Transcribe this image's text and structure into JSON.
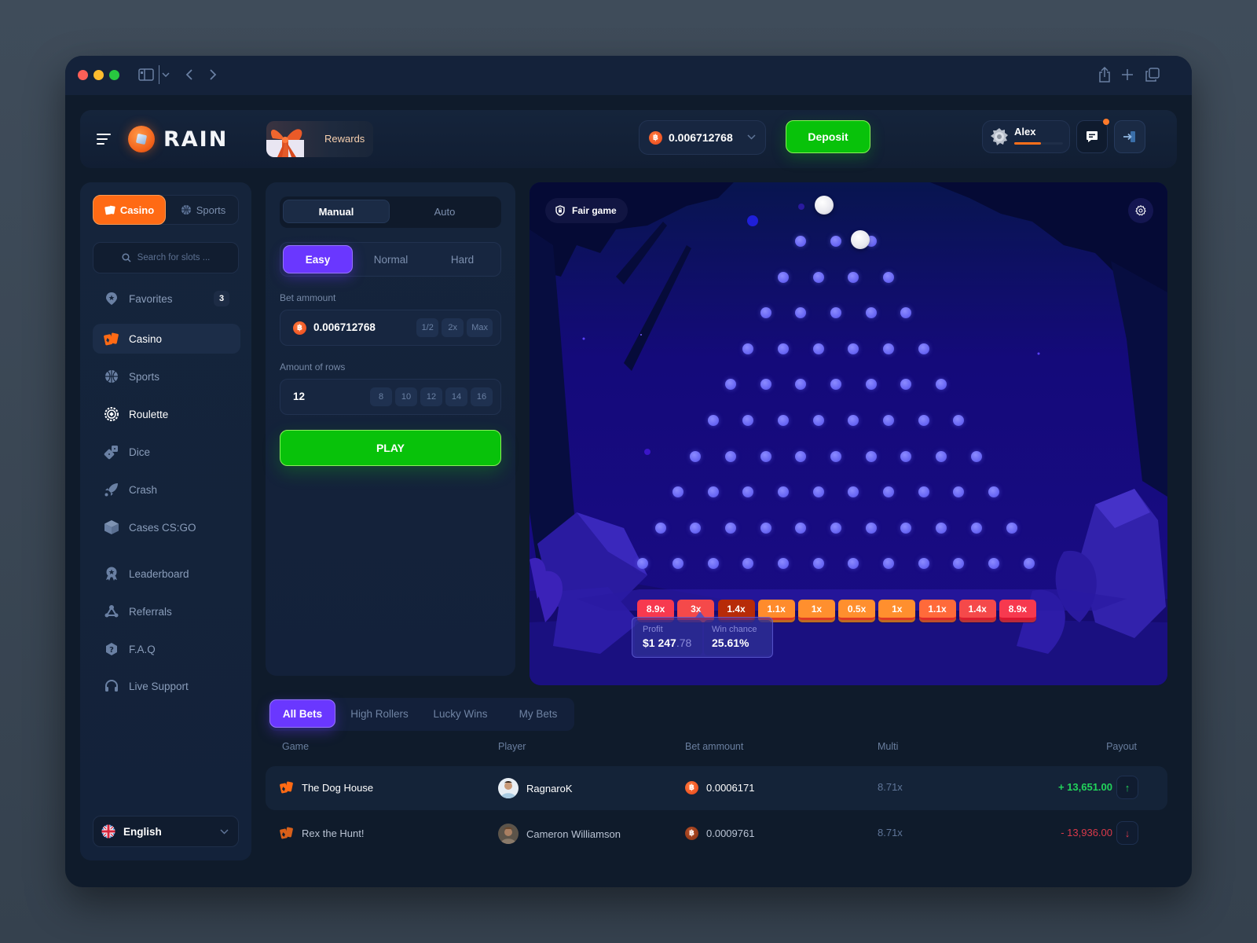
{
  "browser": {
    "traffic_lights": [
      "close",
      "minimize",
      "zoom"
    ],
    "toolbar_icons": [
      "sidebar-icon",
      "chevron-down-icon",
      "back-icon",
      "forward-icon",
      "share-icon",
      "plus-icon",
      "tabs-icon"
    ]
  },
  "header": {
    "brand": "RAIN",
    "rewards_label": "Rewards",
    "balance": "0.006712768",
    "currency_symbol": "฿",
    "deposit_label": "Deposit",
    "user_name": "Alex",
    "level_progress": 0.55,
    "chat_notification": true
  },
  "sidebar": {
    "segment": {
      "casino": "Casino",
      "sports": "Sports",
      "active": "casino"
    },
    "search_placeholder": "Search for slots ...",
    "items": [
      {
        "label": "Favorites",
        "icon": "favorites-icon",
        "badge": "3"
      },
      {
        "label": "Casino",
        "icon": "cards-icon",
        "active": true
      },
      {
        "label": "Sports",
        "icon": "basketball-icon"
      },
      {
        "label": "Roulette",
        "icon": "roulette-icon"
      },
      {
        "label": "Dice",
        "icon": "dice-icon"
      },
      {
        "label": "Crash",
        "icon": "rocket-icon"
      },
      {
        "label": "Cases CS:GO",
        "icon": "box-icon"
      },
      {
        "label": "Leaderboard",
        "icon": "medal-icon"
      },
      {
        "label": "Referrals",
        "icon": "network-icon"
      },
      {
        "label": "F.A.Q",
        "icon": "question-icon"
      },
      {
        "label": "Live Support",
        "icon": "headset-icon"
      }
    ],
    "language": "English"
  },
  "controls": {
    "mode_tabs": [
      "Manual",
      "Auto"
    ],
    "mode_active": "Manual",
    "difficulty": [
      "Easy",
      "Normal",
      "Hard"
    ],
    "difficulty_active": "Easy",
    "bet_label": "Bet ammount",
    "bet_value": "0.006712768",
    "bet_chips": [
      "1/2",
      "2x",
      "Max"
    ],
    "rows_label": "Amount of rows",
    "rows_value": "12",
    "rows_chips": [
      "8",
      "10",
      "12",
      "14",
      "16"
    ],
    "play_label": "PLAY"
  },
  "game": {
    "fair_label": "Fair game",
    "peg_rows": 10,
    "peg_first_row_count": 3,
    "multipliers": [
      {
        "label": "8.9x",
        "color": "#f7394f"
      },
      {
        "label": "3x",
        "color": "#f5494a"
      },
      {
        "label": "1.4x",
        "color": "#b72b08"
      },
      {
        "label": "1.1x",
        "color": "#ff8b2c"
      },
      {
        "label": "1x",
        "color": "#ff8f2e"
      },
      {
        "label": "0.5x",
        "color": "#ff8f2e"
      },
      {
        "label": "1x",
        "color": "#ff8f2e"
      },
      {
        "label": "1.1x",
        "color": "#ff6a3a"
      },
      {
        "label": "1.4x",
        "color": "#f5494a"
      },
      {
        "label": "8.9x",
        "color": "#f7394f"
      }
    ],
    "profit_label": "Profit",
    "profit_main": "$1 247",
    "profit_cents": ".78",
    "win_chance_label": "Win chance",
    "win_chance_value": "25.61%"
  },
  "bets": {
    "tabs": [
      "All Bets",
      "High Rollers",
      "Lucky Wins",
      "My Bets"
    ],
    "active_tab": "All Bets",
    "columns": [
      "Game",
      "Player",
      "Bet ammount",
      "Multi",
      "Payout"
    ],
    "rows": [
      {
        "game": "The Dog House",
        "player": "RagnaroK",
        "bet": "0.0006171",
        "multi": "8.71x",
        "payout": "+ 13,651.00",
        "direction": "up"
      },
      {
        "game": "Rex the Hunt!",
        "player": "Cameron Williamson",
        "bet": "0.0009761",
        "multi": "8.71x",
        "payout": "- 13,936.00",
        "direction": "down"
      }
    ]
  },
  "colors": {
    "accent_orange": "#ff6a14",
    "accent_purple": "#6a37ff",
    "accent_green": "#08c20a",
    "payout_positive": "#22d35b",
    "payout_negative": "#d9394a"
  }
}
